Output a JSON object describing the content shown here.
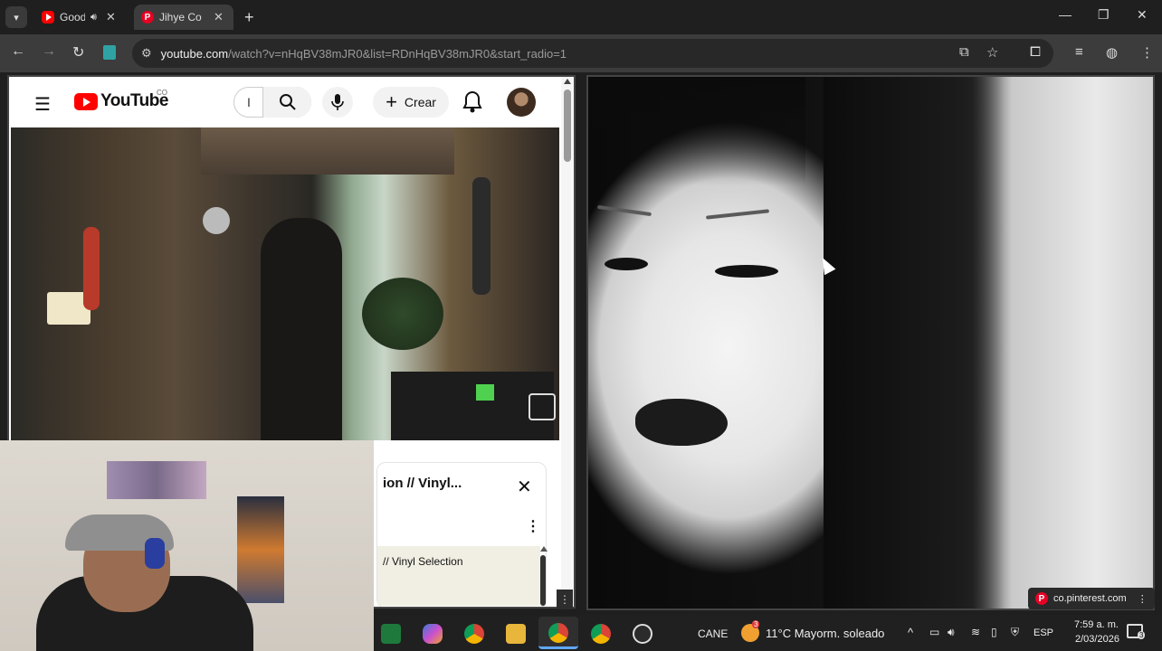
{
  "browser": {
    "tabs": [
      {
        "label": "Good",
        "favicon": "youtube-icon",
        "audio": true
      },
      {
        "label": "Jihye Co",
        "favicon": "pinterest-icon"
      }
    ],
    "new_tab_label": "+",
    "window_controls": {
      "minimize": "—",
      "restore": "❐",
      "close": "✕"
    },
    "url": {
      "host": "youtube.com",
      "path": "/watch?v=nHqBV38mJR0&list=RDnHqBV38mJR0&start_radio=1"
    }
  },
  "youtube": {
    "logo_text": "YouTube",
    "region": "CO",
    "search_placeholder": "",
    "search_cursor": "I",
    "create_label": "Crear",
    "panel": {
      "title": "ion // Vinyl...",
      "item_label": "// Vinyl Selection"
    }
  },
  "pinterest": {
    "source_host": "co.pinterest.com"
  },
  "taskbar": {
    "user_label": "CANE",
    "weather_badge": "3",
    "weather": "11°C  Mayorm. soleado",
    "language": "ESP",
    "time": "7:59 a. m.",
    "date": "2/03/2026",
    "notification_count": "3"
  },
  "colors": {
    "chrome_bg": "#1f1f1f",
    "toolbar_bg": "#3c3c3c",
    "youtube_red": "#ff0000",
    "pinterest_red": "#e60023"
  }
}
